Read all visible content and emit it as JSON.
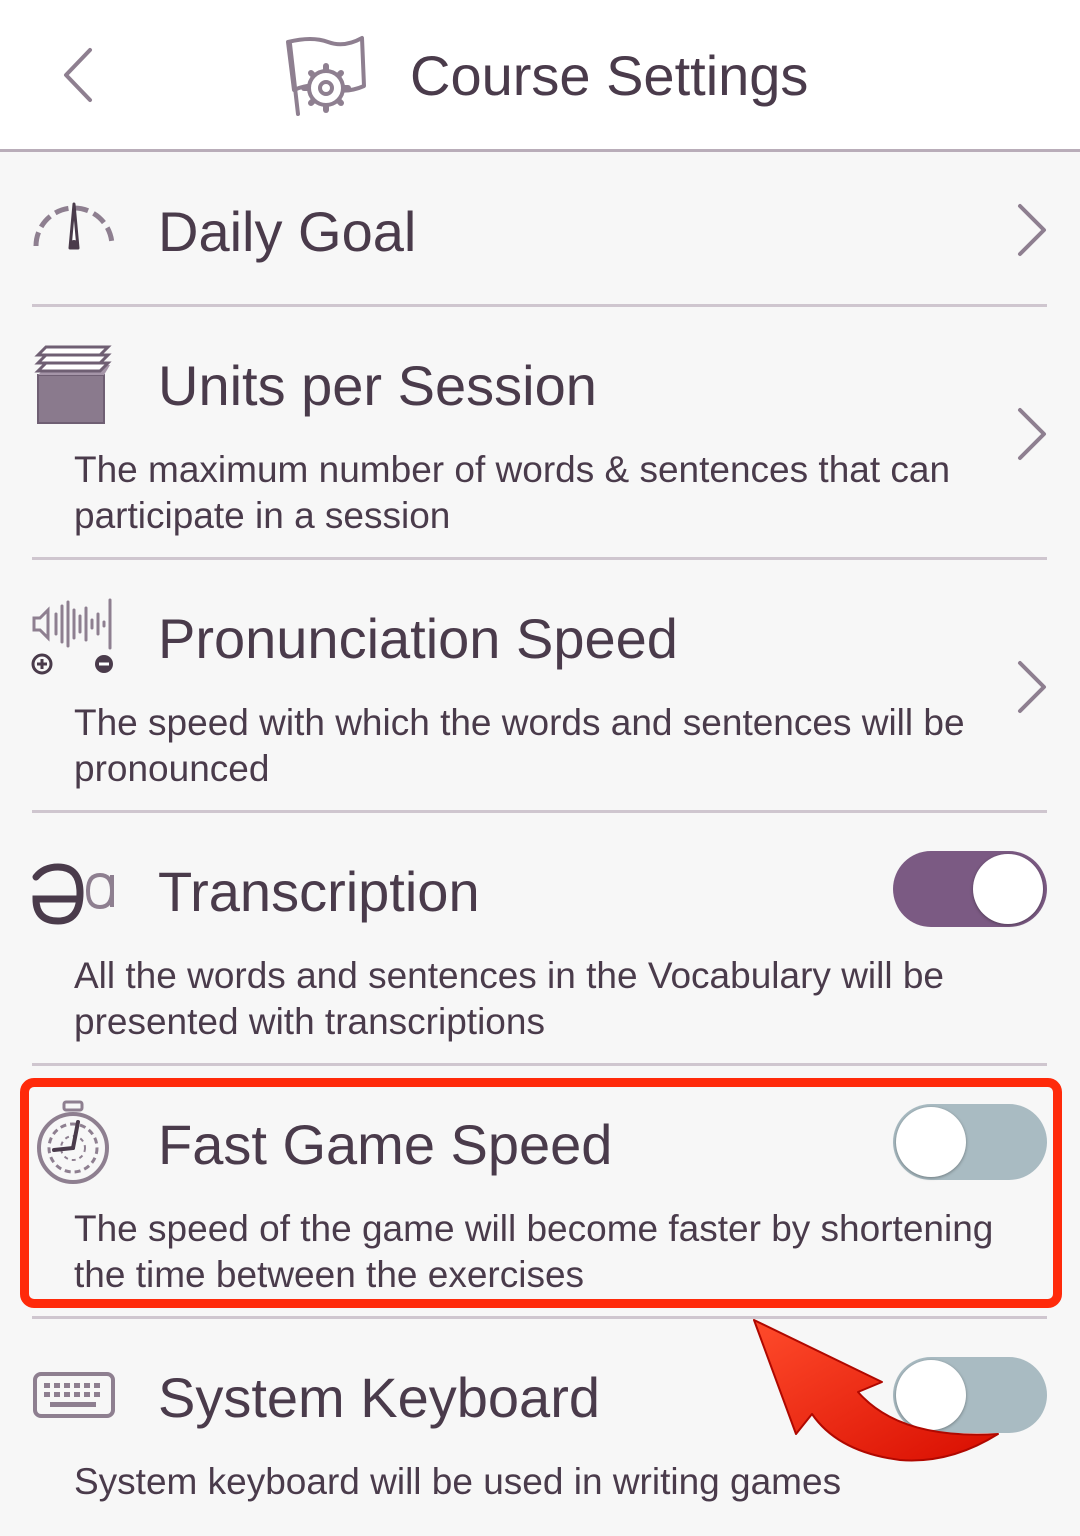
{
  "header": {
    "title": "Course Settings"
  },
  "settings": [
    {
      "title": "Daily Goal"
    },
    {
      "title": "Units per Session",
      "description": "The maximum number of words & sentences that can participate in a session"
    },
    {
      "title": "Pronunciation Speed",
      "description": "The speed with which the words and sentences will be pronounced"
    },
    {
      "title": "Transcription",
      "description": "All the words and sentences in the Vocabulary will be presented with transcriptions",
      "enabled": true
    },
    {
      "title": "Fast Game Speed",
      "description": "The speed of the game will become faster by shortening the time between the exercises",
      "enabled": false
    },
    {
      "title": "System Keyboard",
      "description": "System keyboard will be used in writing games",
      "enabled": false
    }
  ],
  "colors": {
    "accent": "#7b5a83",
    "toggle_off": "#a9bbc2",
    "highlight": "#ff2a0a",
    "text": "#4a3b4b"
  },
  "icons": [
    "back-chevron-icon",
    "course-settings-icon",
    "speedometer-icon",
    "stack-icon",
    "sound-wave-icon",
    "transcription-icon",
    "stopwatch-icon",
    "keyboard-icon",
    "chevron-right-icon"
  ]
}
